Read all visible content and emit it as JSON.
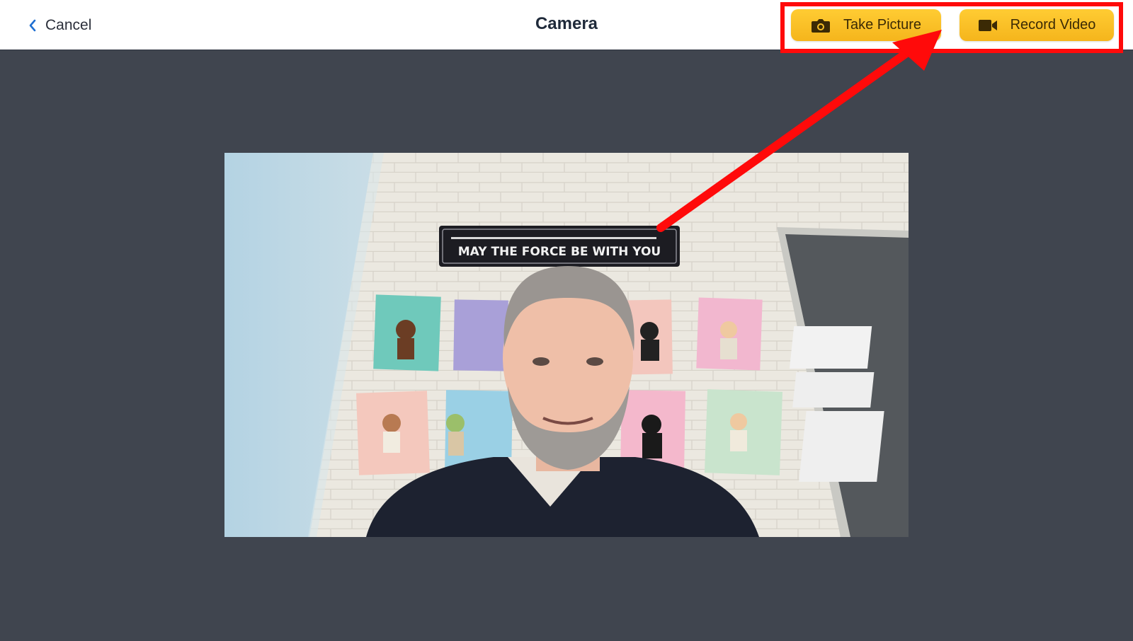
{
  "header": {
    "cancel_label": "Cancel",
    "title": "Camera",
    "take_picture_label": "Take Picture",
    "record_video_label": "Record Video"
  },
  "icons": {
    "back": "chevron-left-icon",
    "camera": "camera-icon",
    "video": "video-camera-icon"
  },
  "preview": {
    "sign_text": "MAY THE FORCE BE WITH YOU"
  },
  "colors": {
    "accent": "#f5b51c",
    "background": "#40454f",
    "annotation": "#ff0a0a",
    "link": "#1f6fd1"
  }
}
